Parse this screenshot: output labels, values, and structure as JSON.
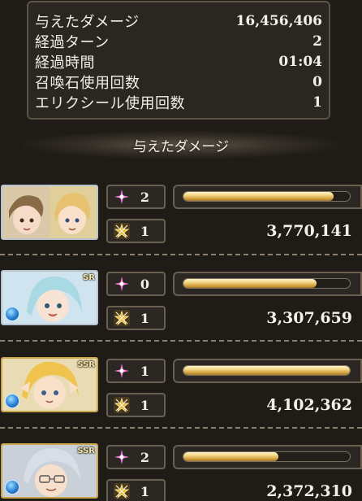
{
  "summary": {
    "rows": [
      {
        "label": "与えたダメージ",
        "value": "16,456,406"
      },
      {
        "label": "経過ターン",
        "value": "2"
      },
      {
        "label": "経過時間",
        "value": "01:04"
      },
      {
        "label": "召喚石使用回数",
        "value": "0"
      },
      {
        "label": "エリクシール使用回数",
        "value": "1"
      }
    ]
  },
  "section": {
    "title": "与えたダメージ"
  },
  "characters": [
    {
      "rarity": "",
      "element": "",
      "charge_attacks": "2",
      "skills": "1",
      "damage": "3,770,141",
      "gauge_fill": 0.9
    },
    {
      "rarity": "SR",
      "element": "water",
      "charge_attacks": "0",
      "skills": "1",
      "damage": "3,307,659",
      "gauge_fill": 0.8
    },
    {
      "rarity": "SSR",
      "element": "water",
      "charge_attacks": "1",
      "skills": "1",
      "damage": "4,102,362",
      "gauge_fill": 1.0
    },
    {
      "rarity": "SSR",
      "element": "water",
      "charge_attacks": "2",
      "skills": "1",
      "damage": "2,372,310",
      "gauge_fill": 0.57
    }
  ],
  "icons": {
    "charge_attack": "sparkle-burst-icon",
    "skill": "skill-star-icon",
    "element_water": "water-element-icon"
  },
  "colors": {
    "charge_icon": "#ff7be6",
    "skill_icon": "#e8b93a",
    "gauge_fill": "#f0cf7d",
    "ssr_frame": "#c9a64a",
    "sr_frame": "#b8c3cf"
  }
}
